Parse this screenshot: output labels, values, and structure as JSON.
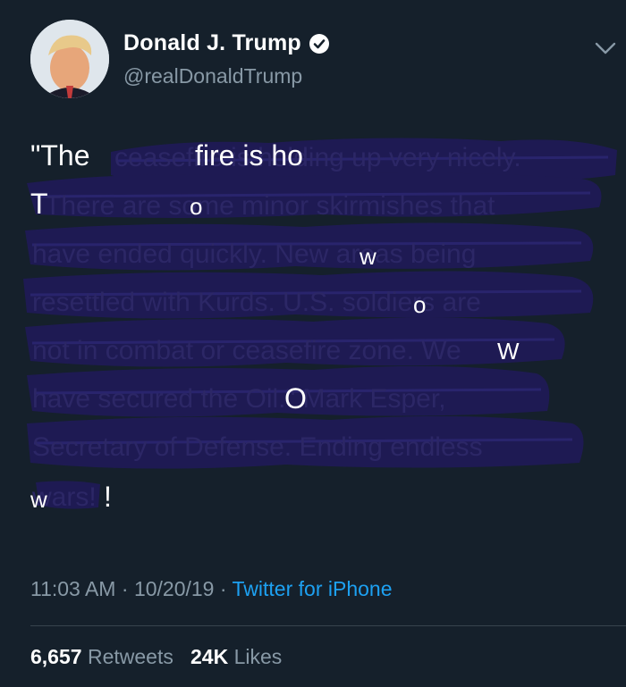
{
  "user": {
    "name": "Donald J. Trump",
    "handle": "@realDonaldTrump"
  },
  "tweet": {
    "fragments": {
      "open": "\"The",
      "fire": "fire is ho",
      "t": "T",
      "o1": "o",
      "w1": "w",
      "o2": "o",
      "w2": "W",
      "o3": "O",
      "w3": "w",
      "excl": "!"
    },
    "obscured_text": {
      "l1": "ceasefire is holding up very nicely.",
      "l2": "There are some minor skirmishes that",
      "l3": "have ended quickly. New areas being",
      "l4": "resettled with Kurds. U.S. soldiers are",
      "l5": "not in combat or ceasefire zone. We",
      "l6": "have secured the Oil.\" Mark Esper,",
      "l7": "Secretary of Defense. Ending endless",
      "l8": "wars!"
    }
  },
  "meta": {
    "time": "11:03 AM",
    "date": "10/20/19",
    "separator": "·",
    "source": "Twitter for iPhone"
  },
  "stats": {
    "retweets": "6,657",
    "retweets_label": "Retweets",
    "likes": "24K",
    "likes_label": "Likes"
  }
}
